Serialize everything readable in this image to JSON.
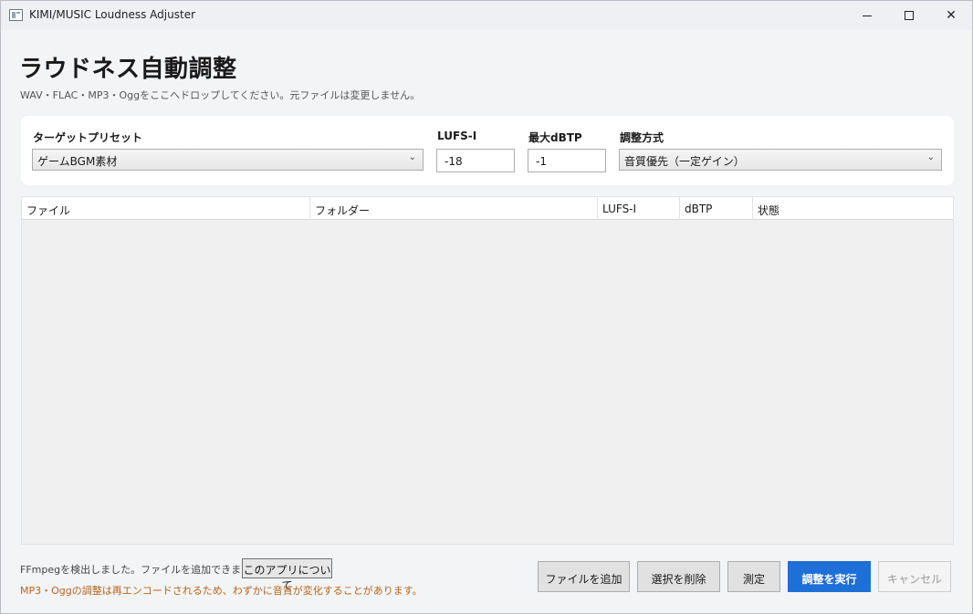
{
  "window": {
    "title": "KIMI/MUSIC Loudness Adjuster",
    "controls": {
      "minimize": "minimize",
      "maximize": "maximize",
      "close": "✕"
    }
  },
  "header": {
    "title": "ラウドネス自動調整",
    "subtitle": "WAV・FLAC・MP3・Oggをここへドロップしてください。元ファイルは変更しません。"
  },
  "settings": {
    "preset_label": "ターゲットプリセット",
    "preset_value": "ゲームBGM素材",
    "lufs_label": "LUFS-I",
    "lufs_value": "-18",
    "dbtp_label": "最大dBTP",
    "dbtp_value": "-1",
    "method_label": "調整方式",
    "method_value": "音質優先（一定ゲイン）"
  },
  "table": {
    "columns": [
      "ファイル",
      "フォルダー",
      "LUFS-I",
      "dBTP",
      "状態"
    ],
    "rows": []
  },
  "footer": {
    "status": "FFmpegを検出しました。ファイルを追加できます。",
    "about_button": "このアプリについて",
    "warning": "MP3・Oggの調整は再エンコードされるため、わずかに音質が変化することがあります。",
    "add_button": "ファイルを追加",
    "remove_button": "選択を削除",
    "measure_button": "測定",
    "run_button": "調整を実行",
    "cancel_button": "キャンセル"
  },
  "colors": {
    "primary": "#1f6fd8",
    "warning_text": "#b5651d"
  },
  "icons": {
    "app": "app-window-icon",
    "dropdown": "chevron-down-icon"
  }
}
